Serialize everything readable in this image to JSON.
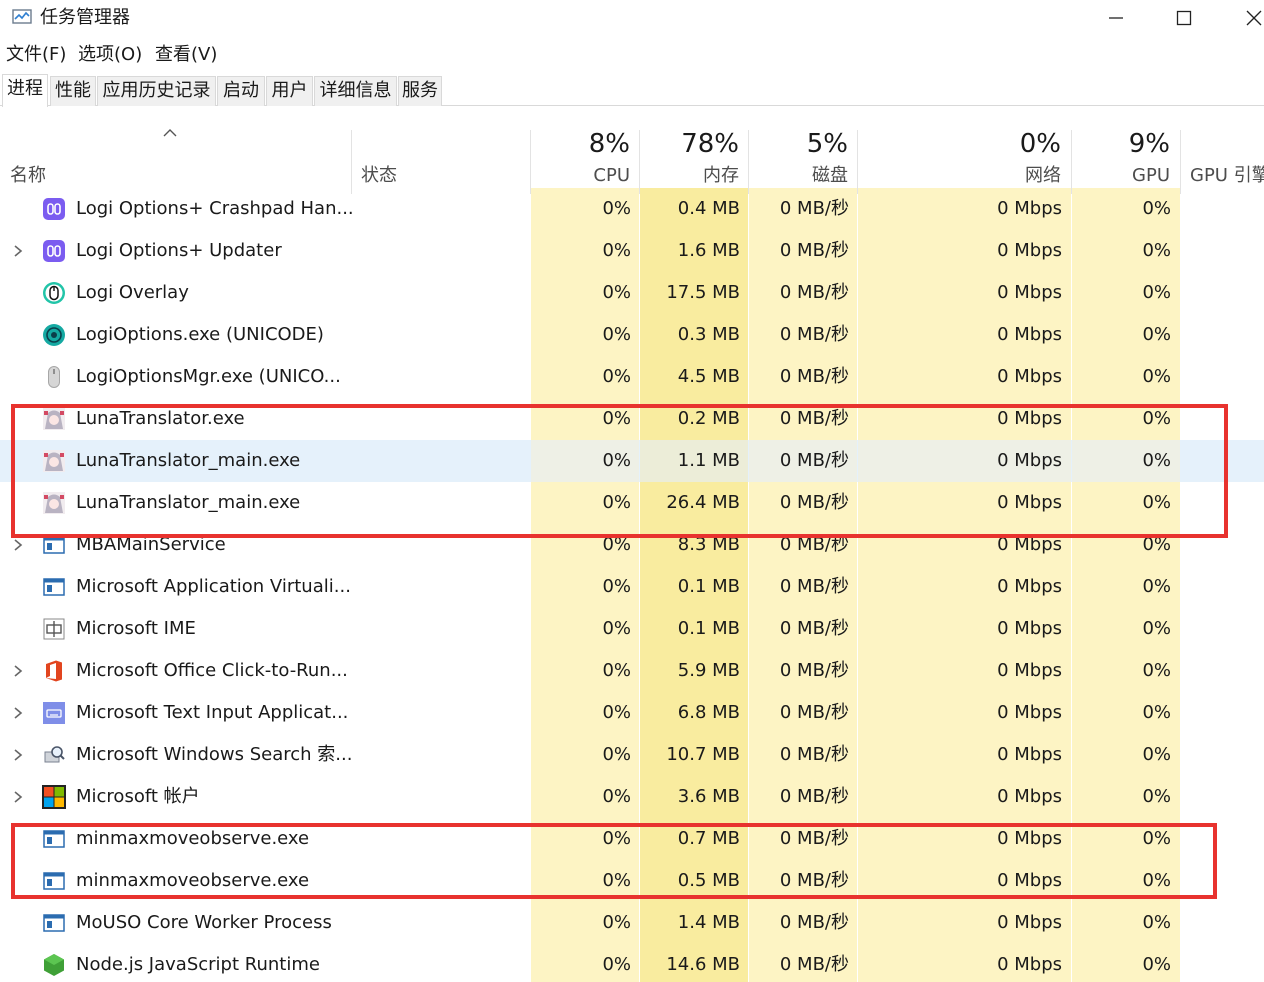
{
  "window": {
    "title": "任务管理器",
    "icon": "task-manager-icon"
  },
  "menu": [
    "文件(F)",
    "选项(O)",
    "查看(V)"
  ],
  "tabs": [
    "进程",
    "性能",
    "应用历史记录",
    "启动",
    "用户",
    "详细信息",
    "服务"
  ],
  "active_tab": "进程",
  "header": {
    "name": "名称",
    "status": "状态",
    "cpu_pct": "8%",
    "cpu": "CPU",
    "mem_pct": "78%",
    "mem": "内存",
    "disk_pct": "5%",
    "disk": "磁盘",
    "net_pct": "0%",
    "net": "网络",
    "gpu_pct": "9%",
    "gpu": "GPU",
    "gpu_engine": "GPU 引擎"
  },
  "processes": [
    {
      "name": "Logi Options+ Crashpad Han...",
      "icon": "logi-options-plus-icon",
      "expandable": false,
      "cpu": "0%",
      "mem": "0.4 MB",
      "disk": "0 MB/秒",
      "net": "0 Mbps",
      "gpu": "0%"
    },
    {
      "name": "Logi Options+ Updater",
      "icon": "logi-options-plus-icon",
      "expandable": true,
      "cpu": "0%",
      "mem": "1.6 MB",
      "disk": "0 MB/秒",
      "net": "0 Mbps",
      "gpu": "0%"
    },
    {
      "name": "Logi Overlay",
      "icon": "logi-overlay-icon",
      "expandable": false,
      "cpu": "0%",
      "mem": "17.5 MB",
      "disk": "0 MB/秒",
      "net": "0 Mbps",
      "gpu": "0%"
    },
    {
      "name": "LogiOptions.exe (UNICODE)",
      "icon": "logi-options-icon",
      "expandable": false,
      "cpu": "0%",
      "mem": "0.3 MB",
      "disk": "0 MB/秒",
      "net": "0 Mbps",
      "gpu": "0%"
    },
    {
      "name": "LogiOptionsMgr.exe (UNICO...",
      "icon": "mouse-icon",
      "expandable": false,
      "cpu": "0%",
      "mem": "4.5 MB",
      "disk": "0 MB/秒",
      "net": "0 Mbps",
      "gpu": "0%"
    },
    {
      "name": "LunaTranslator.exe",
      "icon": "luna-translator-icon",
      "expandable": false,
      "cpu": "0%",
      "mem": "0.2 MB",
      "disk": "0 MB/秒",
      "net": "0 Mbps",
      "gpu": "0%"
    },
    {
      "name": "LunaTranslator_main.exe",
      "icon": "luna-translator-icon",
      "expandable": false,
      "cpu": "0%",
      "mem": "1.1 MB",
      "disk": "0 MB/秒",
      "net": "0 Mbps",
      "gpu": "0%",
      "hover": true
    },
    {
      "name": "LunaTranslator_main.exe",
      "icon": "luna-translator-icon",
      "expandable": false,
      "cpu": "0%",
      "mem": "26.4 MB",
      "disk": "0 MB/秒",
      "net": "0 Mbps",
      "gpu": "0%"
    },
    {
      "name": "MBAMainService",
      "icon": "window-app-icon",
      "expandable": true,
      "cpu": "0%",
      "mem": "8.3 MB",
      "disk": "0 MB/秒",
      "net": "0 Mbps",
      "gpu": "0%"
    },
    {
      "name": "Microsoft Application Virtuali...",
      "icon": "window-app-icon",
      "expandable": false,
      "cpu": "0%",
      "mem": "0.1 MB",
      "disk": "0 MB/秒",
      "net": "0 Mbps",
      "gpu": "0%"
    },
    {
      "name": "Microsoft IME",
      "icon": "ime-icon",
      "expandable": false,
      "cpu": "0%",
      "mem": "0.1 MB",
      "disk": "0 MB/秒",
      "net": "0 Mbps",
      "gpu": "0%"
    },
    {
      "name": "Microsoft Office Click-to-Run...",
      "icon": "office-icon",
      "expandable": true,
      "cpu": "0%",
      "mem": "5.9 MB",
      "disk": "0 MB/秒",
      "net": "0 Mbps",
      "gpu": "0%"
    },
    {
      "name": "Microsoft Text Input Applicat...",
      "icon": "keyboard-icon",
      "expandable": true,
      "cpu": "0%",
      "mem": "6.8 MB",
      "disk": "0 MB/秒",
      "net": "0 Mbps",
      "gpu": "0%"
    },
    {
      "name": "Microsoft Windows Search 索...",
      "icon": "search-indexer-icon",
      "expandable": true,
      "cpu": "0%",
      "mem": "10.7 MB",
      "disk": "0 MB/秒",
      "net": "0 Mbps",
      "gpu": "0%"
    },
    {
      "name": "Microsoft 帐户",
      "icon": "microsoft-logo-icon",
      "expandable": true,
      "cpu": "0%",
      "mem": "3.6 MB",
      "disk": "0 MB/秒",
      "net": "0 Mbps",
      "gpu": "0%"
    },
    {
      "name": "minmaxmoveobserve.exe",
      "icon": "window-app-icon",
      "expandable": false,
      "cpu": "0%",
      "mem": "0.7 MB",
      "disk": "0 MB/秒",
      "net": "0 Mbps",
      "gpu": "0%"
    },
    {
      "name": "minmaxmoveobserve.exe",
      "icon": "window-app-icon",
      "expandable": false,
      "cpu": "0%",
      "mem": "0.5 MB",
      "disk": "0 MB/秒",
      "net": "0 Mbps",
      "gpu": "0%"
    },
    {
      "name": "MoUSO Core Worker Process",
      "icon": "window-app-icon",
      "expandable": false,
      "cpu": "0%",
      "mem": "1.4 MB",
      "disk": "0 MB/秒",
      "net": "0 Mbps",
      "gpu": "0%"
    },
    {
      "name": "Node.js JavaScript Runtime",
      "icon": "nodejs-icon",
      "expandable": false,
      "cpu": "0%",
      "mem": "14.6 MB",
      "disk": "0 MB/秒",
      "net": "0 Mbps",
      "gpu": "0%"
    }
  ],
  "highlight_color": "#e8322e",
  "accent_colors": {
    "heat_light": "#fdf4c4",
    "heat_mem": "#f9ec9f",
    "hover": "#e5f1fb"
  }
}
